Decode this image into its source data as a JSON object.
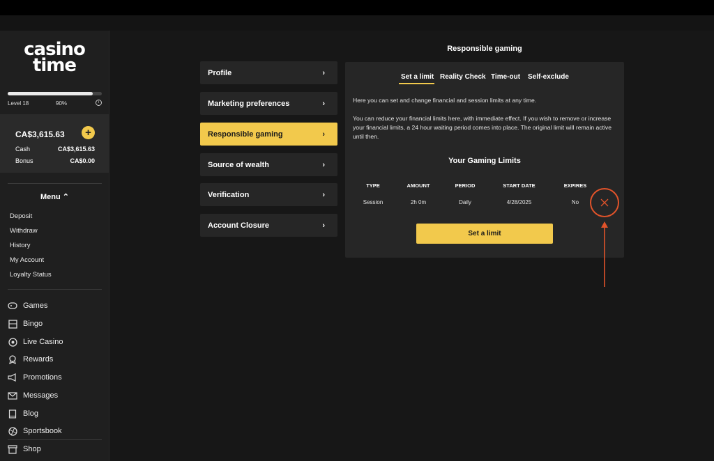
{
  "sidebar": {
    "logo_line1": "casino",
    "logo_line2": "time",
    "level_label": "Level 18",
    "progress_label": "90%",
    "progress": 0.9,
    "balance": "CA$3,615.63",
    "cash_label": "Cash",
    "cash_value": "CA$3,615.63",
    "bonus_label": "Bonus",
    "bonus_value": "CA$0.00",
    "menu_label": "Menu",
    "menu_items": [
      "Deposit",
      "Withdraw",
      "History",
      "My Account",
      "Loyalty Status"
    ],
    "nav_items": [
      {
        "label": "Games",
        "icon": "gamepad-icon"
      },
      {
        "label": "Bingo",
        "icon": "bingo-icon"
      },
      {
        "label": "Live Casino",
        "icon": "live-icon"
      },
      {
        "label": "Rewards",
        "icon": "ribbon-icon"
      },
      {
        "label": "Promotions",
        "icon": "megaphone-icon"
      },
      {
        "label": "Messages",
        "icon": "mail-icon"
      },
      {
        "label": "Blog",
        "icon": "book-icon"
      },
      {
        "label": "Sportsbook",
        "icon": "ball-icon"
      },
      {
        "label": "Shop",
        "icon": "shop-icon"
      }
    ]
  },
  "page": {
    "title": "Responsible gaming",
    "tabs": [
      "Profile",
      "Marketing preferences",
      "Responsible gaming",
      "Source of wealth",
      "Verification",
      "Account Closure"
    ],
    "active_tab": "Responsible gaming"
  },
  "panel": {
    "subtabs": [
      "Set a limit",
      "Reality Check",
      "Time-out",
      "Self-exclude"
    ],
    "intro": "Here you can set and change financial and session limits at any time.",
    "body": "You can reduce your financial limits here, with immediate effect. If you wish to remove or increase your financial limits, a 24 hour waiting period comes into place. The original limit will remain active until then.",
    "limits_title": "Your Gaming Limits",
    "columns": [
      "TYPE",
      "AMOUNT",
      "PERIOD",
      "START DATE",
      "EXPIRES"
    ],
    "row": [
      "Session",
      "2h 0m",
      "Daily",
      "4/28/2025",
      "No"
    ],
    "set_limit_button": "Set a limit"
  },
  "colors": {
    "accent": "#f2c94c",
    "highlight": "#e0532a"
  }
}
